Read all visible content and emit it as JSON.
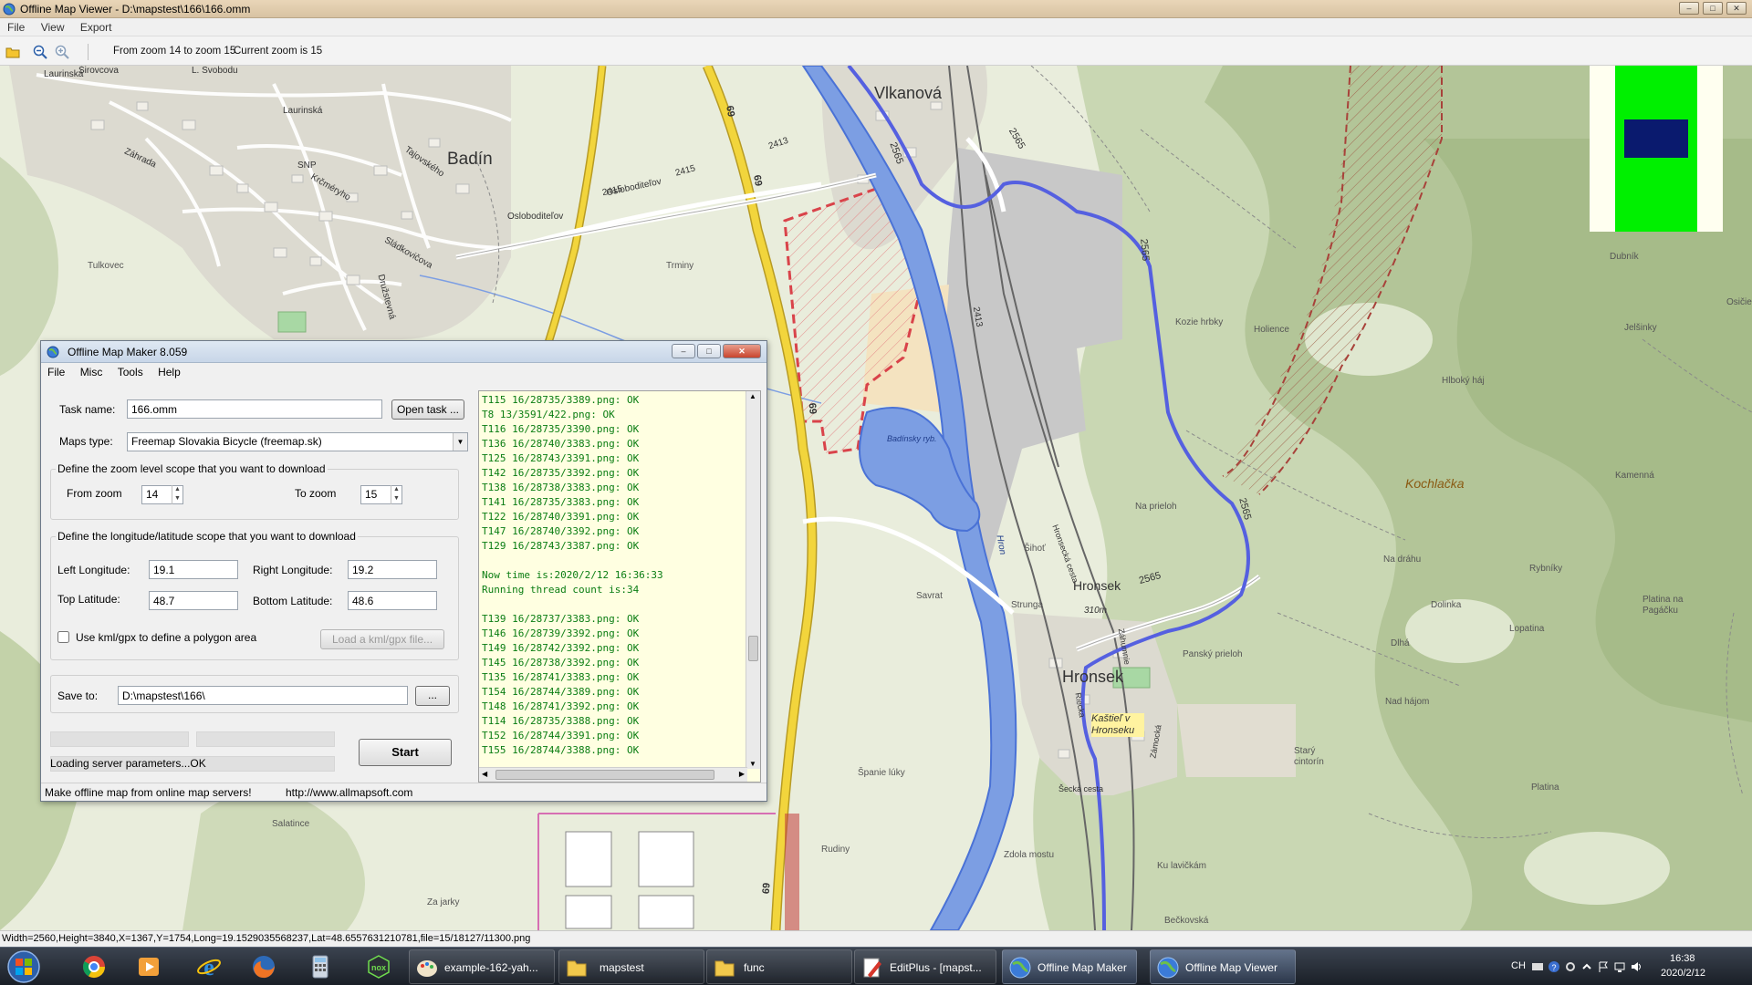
{
  "window": {
    "title": "Offline Map Viewer - D:\\mapstest\\166\\166.omm",
    "menu": [
      "File",
      "View",
      "Export"
    ]
  },
  "toolbar": {
    "zoom_range": "From zoom 14 to zoom 15",
    "current_zoom": "Current zoom is 15"
  },
  "map": {
    "labels": {
      "badin": "Badín",
      "vlkanova": "Vlkanová",
      "hronsek": "Hronsek",
      "hronsek_small": "Hronsek",
      "kochlacka": "Kochlačka",
      "kastiel": "Kaštieľ v Hronseku",
      "badinsky_ryb": "Badínsky ryb.",
      "laurinska": "Laurinská",
      "laurinska2": "Laurinská",
      "svobodu": "L. Svobodu",
      "sirovcova": "Širovcova",
      "tajovskeho": "Tajovského",
      "zahrada": "Záhrada",
      "kremnicka": "Krčméryho",
      "snp": "SNP",
      "sladkovicova": "Sládkovičova",
      "druzstevna": "Družstevná",
      "osloboditelov": "Osloboditeľov",
      "osloboditelov2": "Osloboditeľov",
      "tulkovec": "Tulkovec",
      "trminy": "Trminy",
      "koziehrby": "Kozie hrbky",
      "holience": "Holience",
      "na_prieloh": "Na prieloh",
      "sihot": "Šihoť",
      "savrat": "Savrat",
      "strunga": "Strunga",
      "pansky_prieloh": "Panský prieloh",
      "stary_cintorin": "Starý cintorín",
      "spanie_luky": "Španie lúky",
      "rudiny": "Rudiny",
      "zdola_mostu": "Zdola mostu",
      "ku_lavickam": "Ku lavičkám",
      "becova": "Bečkovská",
      "za_jarky": "Za jarky",
      "salatince": "Salatince",
      "kamenna": "Kamenná",
      "na_drahu": "Na dráhu",
      "rybniky": "Rybníky",
      "dolinka": "Dolinka",
      "dlha": "Dlhá",
      "lopatina": "Lopatina",
      "nad_hajom": "Nad hájom",
      "platina": "Platina",
      "platina_pagacku": "Platina na Pagáčku",
      "hlboky_haj": "Hlboký háj",
      "jelsinky": "Jelšinky",
      "dubnik": "Dubník",
      "osice": "Osičie",
      "hron": "Hron",
      "road69a": "69",
      "road69b": "69",
      "road69c": "69",
      "road69d": "69",
      "road2413a": "2413",
      "road2413b": "2413",
      "road2415": "2415",
      "road2415b": "2415",
      "road2565a": "2565",
      "road2565b": "2565",
      "road2565c": "2565",
      "road2565d": "2565",
      "road2565e": "2565",
      "altitude": "310m",
      "hronsecka_cesta": "Hronsecká cesta",
      "zahumnie": "Záhumnie",
      "zamocka": "Zámocká",
      "becka_cesta": "Šecká cesta",
      "riecka": "Riecka"
    },
    "status": "Width=2560,Height=3840,X=1367,Y=1754,Long=19.1529035568237,Lat=48.6557631210781,file=15/18127/11300.png"
  },
  "dialog": {
    "title": "Offline Map Maker 8.059",
    "menu": [
      "File",
      "Misc",
      "Tools",
      "Help"
    ],
    "task_name_label": "Task name:",
    "task_name_value": "166.omm",
    "open_task_button": "Open task ...",
    "maps_type_label": "Maps type:",
    "maps_type_value": "Freemap Slovakia Bicycle (freemap.sk)",
    "zoom_group_title": "Define the zoom level scope that you want to download",
    "from_zoom_label": "From zoom",
    "from_zoom_value": "14",
    "to_zoom_label": "To zoom",
    "to_zoom_value": "15",
    "lonlat_group_title": "Define the longitude/latitude scope that you want to download",
    "left_lon_label": "Left Longitude:",
    "left_lon_value": "19.1",
    "right_lon_label": "Right Longitude:",
    "right_lon_value": "19.2",
    "top_lat_label": "Top Latitude:",
    "top_lat_value": "48.7",
    "bottom_lat_label": "Bottom Latitude:",
    "bottom_lat_value": "48.6",
    "kml_checkbox_label": "Use kml/gpx to define a polygon area",
    "kml_checked": false,
    "load_kml_button": "Load a kml/gpx file...",
    "save_to_label": "Save to:",
    "save_to_value": "D:\\mapstest\\166\\",
    "browse_button": "...",
    "progress_1": 0,
    "progress_2": 0,
    "progress_3": 0,
    "status_text": "Loading server parameters...OK",
    "start_button": "Start",
    "log_lines": [
      "T115 16/28735/3389.png: OK",
      "T8 13/3591/422.png: OK",
      "T116 16/28735/3390.png: OK",
      "T136 16/28740/3383.png: OK",
      "T125 16/28743/3391.png: OK",
      "T142 16/28735/3392.png: OK",
      "T138 16/28738/3383.png: OK",
      "T141 16/28735/3383.png: OK",
      "T122 16/28740/3391.png: OK",
      "T147 16/28740/3392.png: OK",
      "T129 16/28743/3387.png: OK",
      "",
      "Now time is:2020/2/12 16:36:33",
      "Running thread count is:34",
      "",
      "T139 16/28737/3383.png: OK",
      "T146 16/28739/3392.png: OK",
      "T149 16/28742/3392.png: OK",
      "T145 16/28738/3392.png: OK",
      "T135 16/28741/3383.png: OK",
      "T154 16/28744/3389.png: OK",
      "T148 16/28741/3392.png: OK",
      "T114 16/28735/3388.png: OK",
      "T152 16/28744/3391.png: OK",
      "T155 16/28744/3388.png: OK"
    ],
    "footer_text": "Make offline map from online map servers!",
    "footer_url": "http://www.allmapsoft.com"
  },
  "taskbar": {
    "tasks": [
      {
        "label": "example-162-yah...",
        "icon": "paint-icon"
      },
      {
        "label": "mapstest",
        "icon": "folder-icon"
      },
      {
        "label": "func",
        "icon": "folder-icon"
      },
      {
        "label": "EditPlus - [mapst...",
        "icon": "editplus-icon"
      },
      {
        "label": "Offline Map Maker",
        "icon": "globe-icon"
      },
      {
        "label": "Offline Map Viewer",
        "icon": "globe-icon"
      }
    ],
    "tray": {
      "lang": "CH",
      "time": "16:38",
      "date": "2020/2/12"
    }
  },
  "colors": {
    "log_text": "#0a7d12",
    "log_background": "#ffffe1",
    "road_yellow": "#f2d53c",
    "bike_route": "#5560e0",
    "river": "#4a72d6",
    "overview_green": "#00f000",
    "overview_navy": "#0a1a6e"
  }
}
